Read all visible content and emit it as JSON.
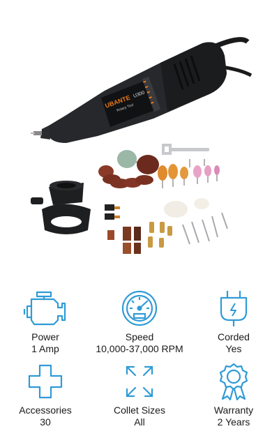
{
  "product": {
    "brand": "UBANTE",
    "model": "U300",
    "subtitle": "Rotary Tool"
  },
  "accent_color": "#2f9bd6",
  "features": [
    {
      "icon": "engine-icon",
      "label": "Power",
      "value": "1 Amp"
    },
    {
      "icon": "speedometer-icon",
      "label": "Speed",
      "value": "10,000-37,000 RPM"
    },
    {
      "icon": "plug-icon",
      "label": "Corded",
      "value": "Yes"
    },
    {
      "icon": "plus-icon",
      "label": "Accessories",
      "value": "30"
    },
    {
      "icon": "expand-arrows-icon",
      "label": "Collet Sizes",
      "value": "All"
    },
    {
      "icon": "award-ribbon-icon",
      "label": "Warranty",
      "value": "2 Years"
    }
  ]
}
